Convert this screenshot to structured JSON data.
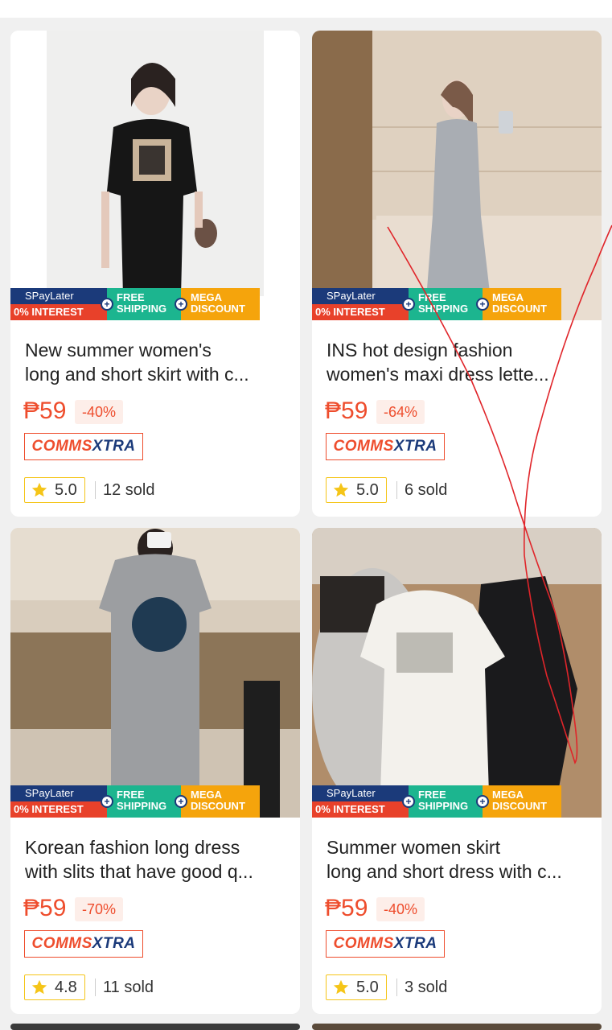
{
  "banner": {
    "spay": "SPayLater",
    "interest": "0% INTEREST",
    "free1": "FREE",
    "free2": "SHIPPING",
    "mega1": "MEGA",
    "mega2": "DISCOUNT"
  },
  "comms": {
    "part1": "COMMS",
    "part2": "XTRA"
  },
  "products": [
    {
      "title_line1": "New summer women's",
      "title_line2": "long and short skirt with c...",
      "price": "₱59",
      "discount": "-40%",
      "rating": "5.0",
      "sold": "12 sold"
    },
    {
      "title_line1": "INS hot design fashion",
      "title_line2": "women's  maxi dress  lette...",
      "price": "₱59",
      "discount": "-64%",
      "rating": "5.0",
      "sold": "6 sold"
    },
    {
      "title_line1": "Korean fashion long dress",
      "title_line2": "with slits that have good q...",
      "price": "₱59",
      "discount": "-70%",
      "rating": "4.8",
      "sold": "11 sold"
    },
    {
      "title_line1": "Summer women skirt",
      "title_line2": "long and short dress with c...",
      "price": "₱59",
      "discount": "-40%",
      "rating": "5.0",
      "sold": "3 sold"
    }
  ],
  "colors": {
    "accent": "#ee4d2d",
    "navy": "#1b3a7a",
    "green": "#1cb58f",
    "orange": "#f5a40c",
    "star": "#f5c518"
  },
  "icons": [
    "star-icon",
    "plus-icon"
  ]
}
